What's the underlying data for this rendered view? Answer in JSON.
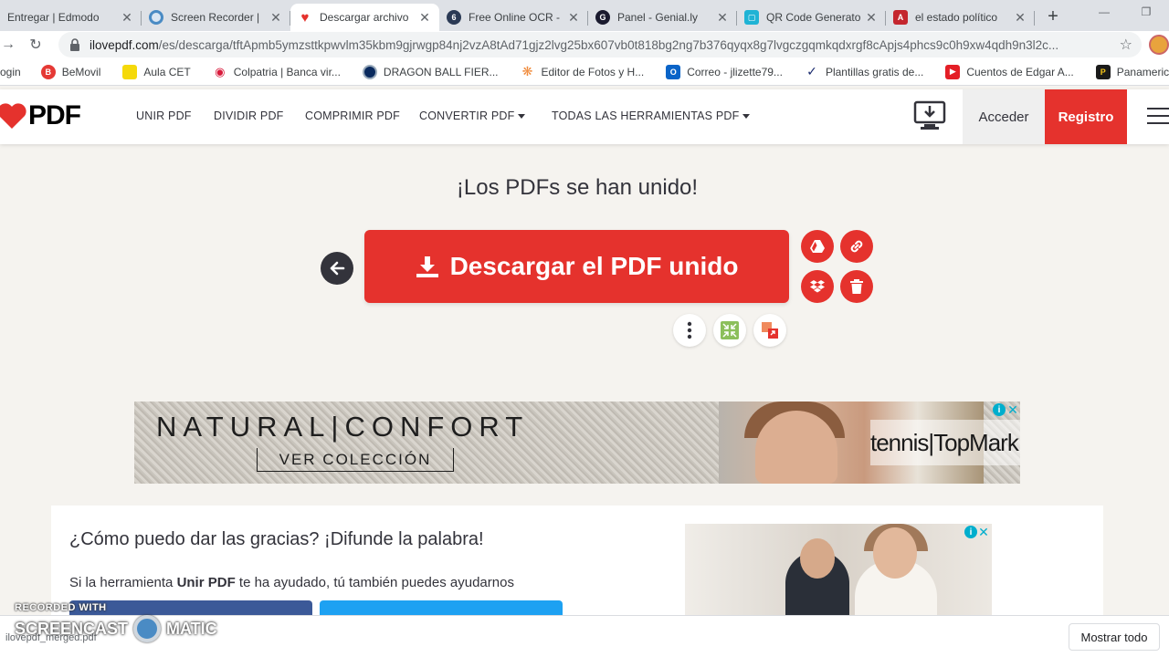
{
  "tabs": [
    {
      "title": "Entregar | Edmodo",
      "favicon": "edmodo-icon",
      "color": "#2a7ae2",
      "active": false
    },
    {
      "title": "Screen Recorder | ",
      "favicon": "screencast-icon",
      "color": "#4a8bc4",
      "active": false
    },
    {
      "title": "Descargar archivo",
      "favicon": "ilovepdf-heart-icon",
      "color": "#e5322d",
      "active": true
    },
    {
      "title": "Free Online OCR - ",
      "favicon": "ocr-icon",
      "color": "#2b3a55",
      "active": false
    },
    {
      "title": "Panel - Genial.ly",
      "favicon": "genially-icon",
      "color": "#1a1a2e",
      "active": false
    },
    {
      "title": "QR Code Generato",
      "favicon": "qr-icon",
      "color": "#1fb3d5",
      "active": false
    },
    {
      "title": "el estado político ",
      "favicon": "doc-icon",
      "color": "#c4262e",
      "active": false
    }
  ],
  "browser": {
    "new_tab": "+",
    "url_domain": "ilovepdf.com",
    "url_path": "/es/descarga/tftApmb5ymzsttkpwvlm35kbm9gjrwgp84nj2vzA8tAd71gjz2lvg25bx607vb0t818bg2ng7b376qyqx8g7lvgczgqmkqdxrgf8cApjs4phcs9c0h9xw4qdh9n3l2c..."
  },
  "bookmarks": [
    {
      "label": "ogin",
      "color": "#ffffff"
    },
    {
      "label": "BeMovil",
      "color": "#e53935"
    },
    {
      "label": "Aula CET",
      "color": "#f5d90a"
    },
    {
      "label": "Colpatria | Banca vir...",
      "color": "#d81b3c"
    },
    {
      "label": "DRAGON BALL FIER...",
      "color": "#0a2a5e"
    },
    {
      "label": "Editor de Fotos y H...",
      "color": "#f08a3a"
    },
    {
      "label": "Correo - jlizette79...",
      "color": "#0a64c8"
    },
    {
      "label": "Plantillas gratis de...",
      "color": "#1a2a6e"
    },
    {
      "label": "Cuentos de Edgar A...",
      "color": "#e41e26"
    },
    {
      "label": "Panamericana Libre...",
      "color": "#1a1a1a"
    }
  ],
  "site": {
    "logo_text": "PDF",
    "nav": [
      "UNIR PDF",
      "DIVIDIR PDF",
      "COMPRIMIR PDF",
      "CONVERTIR PDF",
      "TODAS LAS HERRAMIENTAS PDF"
    ],
    "login": "Acceder",
    "register": "Registro",
    "accent": "#e5322d"
  },
  "main": {
    "headline": "¡Los PDFs se han unido!",
    "download_label": "Descargar el PDF unido"
  },
  "ad": {
    "headline": "NATURAL|CONFORT",
    "cta": "VER COLECCIÓN",
    "brand": "tennis|TopMark"
  },
  "share": {
    "title": "¿Cómo puedo dar las gracias? ¡Difunde la palabra!",
    "text_pre": "Si la herramienta ",
    "text_bold": "Unir PDF",
    "text_post": " te ha ayudado, tú también puedes ayudarnos"
  },
  "download_bar": {
    "file": "ilovepdf_merged.pdf",
    "show_all": "Mostrar todo"
  },
  "watermark": {
    "line1": "RECORDED WITH",
    "left": "SCREENCAST",
    "right": "MATIC"
  }
}
